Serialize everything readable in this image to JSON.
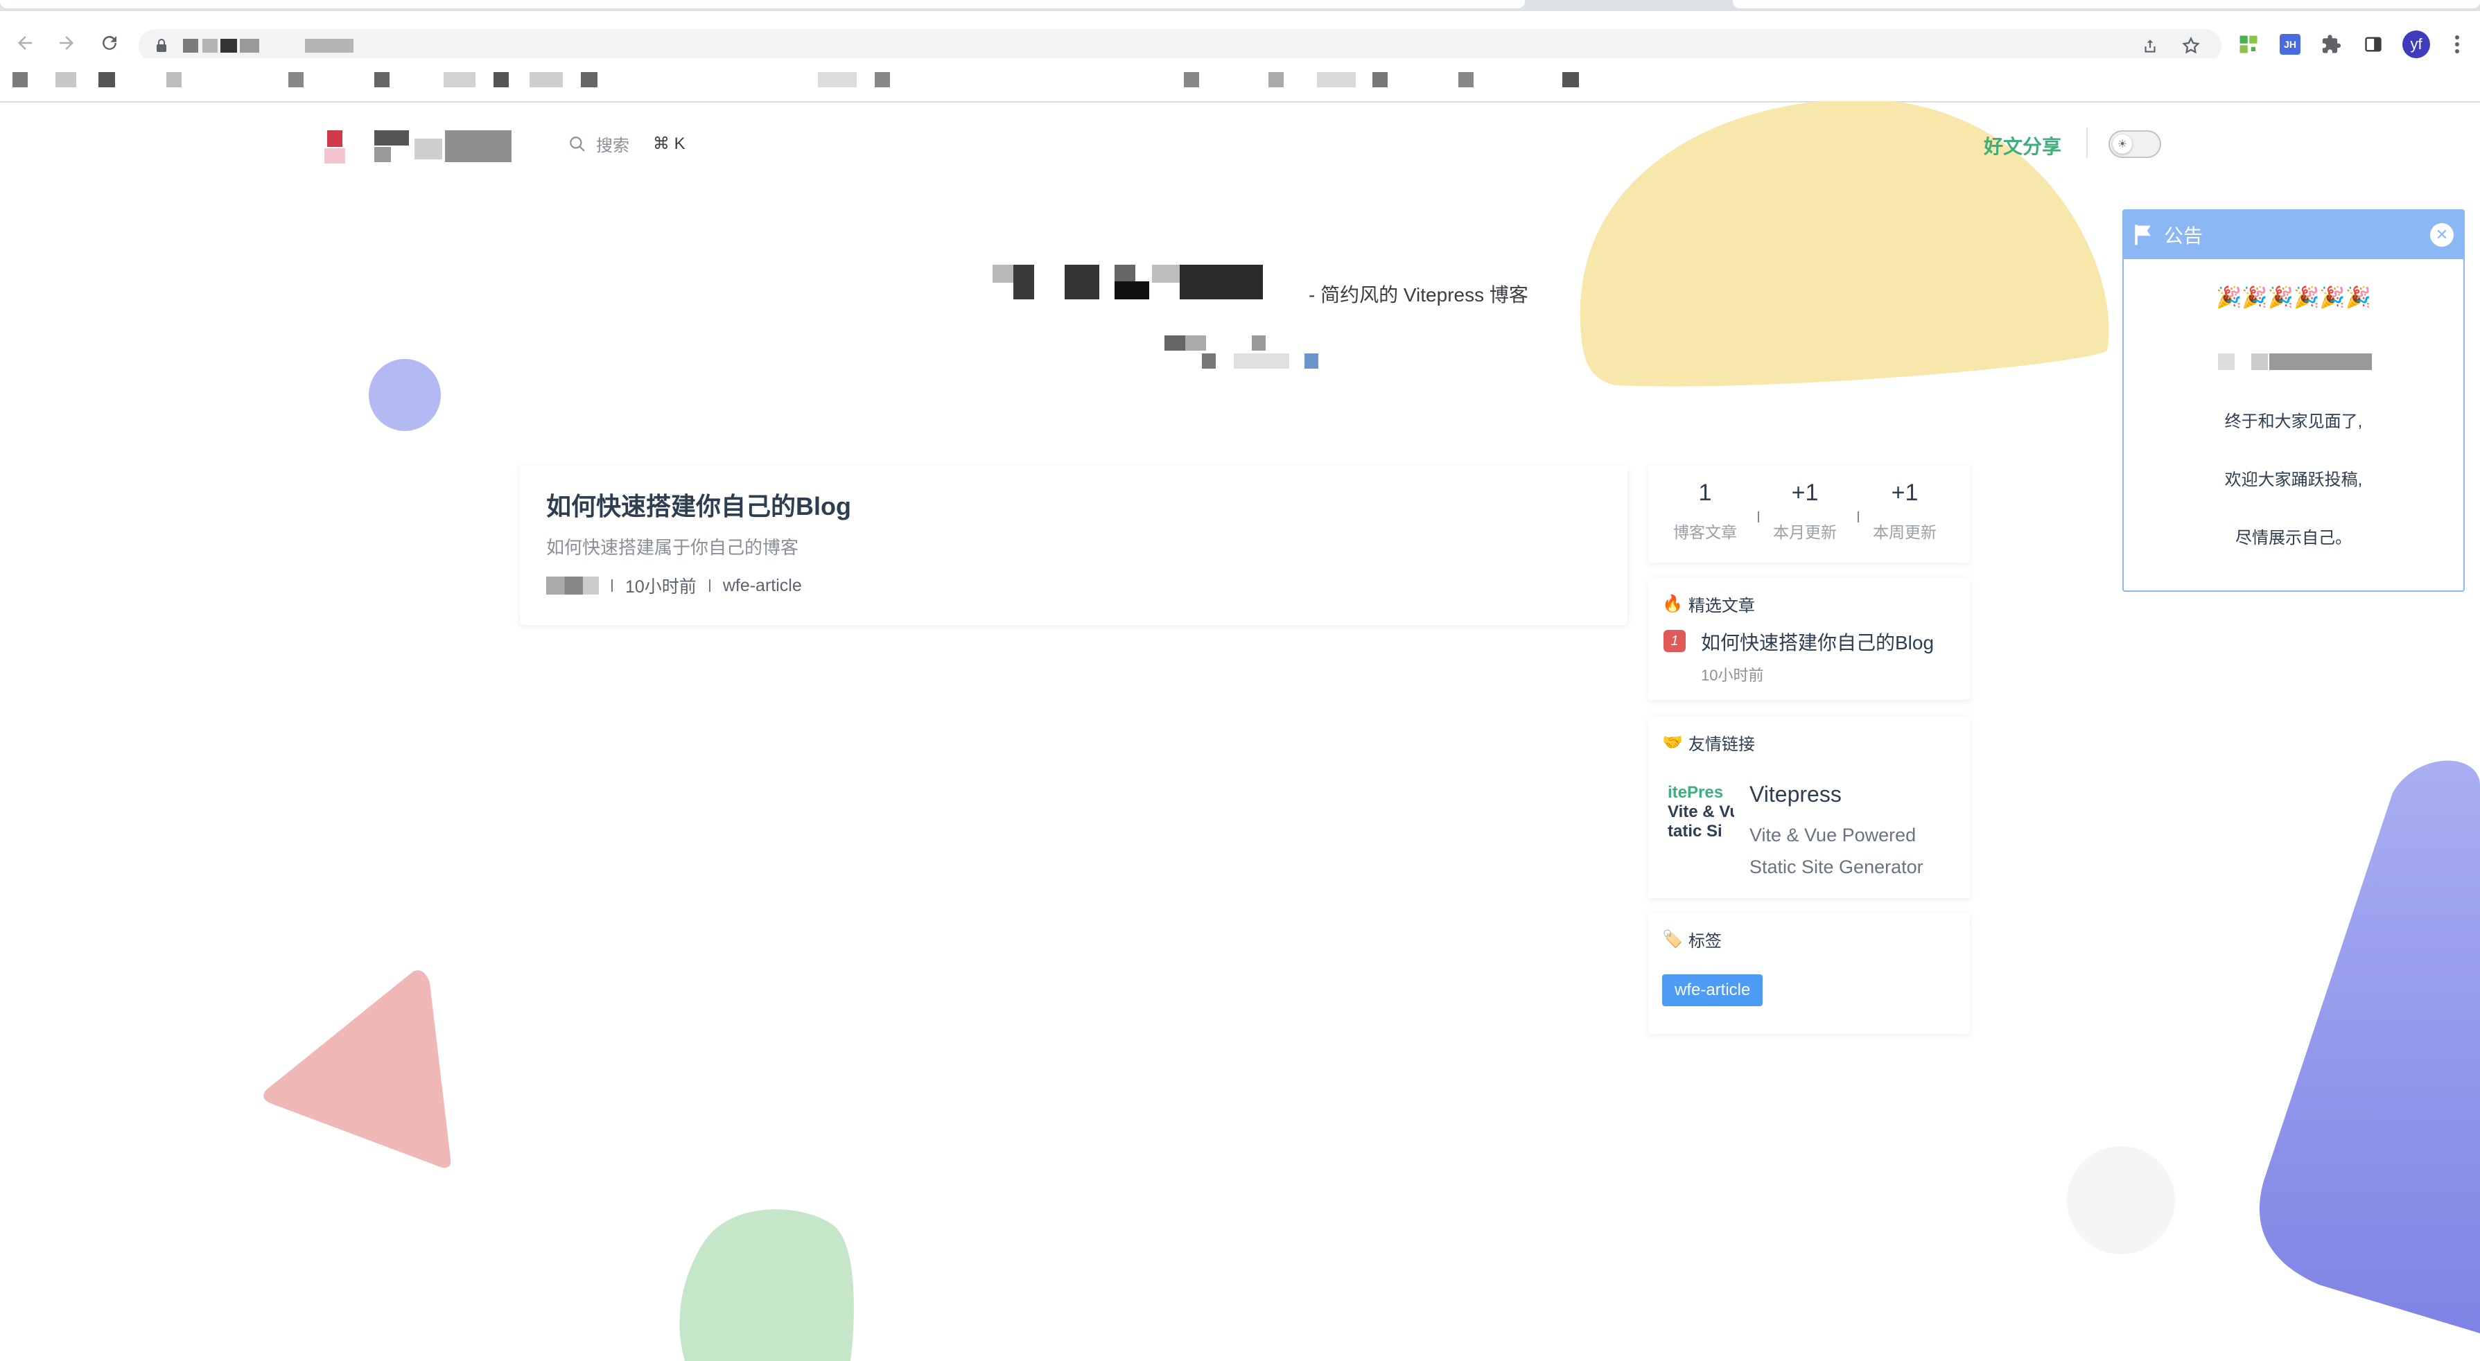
{
  "browser": {
    "address_blurred": "",
    "profile_initials": "yf",
    "ext_jh_label": "JH"
  },
  "header": {
    "search_placeholder": "搜索",
    "search_shortcut": "⌘ K",
    "nav_link": "好文分享"
  },
  "hero": {
    "subtitle": "- 简约风的 Vitepress 博客"
  },
  "post": {
    "title": "如何快速搭建你自己的Blog",
    "description": "如何快速搭建属于你自己的博客",
    "time": "10小时前",
    "tag": "wfe-article"
  },
  "stats": [
    {
      "value": "1",
      "label": "博客文章"
    },
    {
      "value": "+1",
      "label": "本月更新"
    },
    {
      "value": "+1",
      "label": "本周更新"
    }
  ],
  "featured": {
    "title": "精选文章",
    "rank": "1",
    "item_title": "如何快速搭建你自己的Blog",
    "item_time": "10小时前"
  },
  "friends": {
    "title": "友情链接",
    "logo_lines": [
      "itePres",
      "Vite & Vu",
      "tatic Si"
    ],
    "name": "Vitepress",
    "description": "Vite & Vue Powered Static Site Generator"
  },
  "tags": {
    "title": "标签",
    "items": [
      "wfe-article"
    ]
  },
  "notice": {
    "title": "公告",
    "celebrate": "🎉🎉🎉🎉🎉🎉",
    "line1": "终于和大家见面了,",
    "line2": "欢迎大家踊跃投稿,",
    "line3": "尽情展示自己。"
  },
  "colors": {
    "accent": "#3eaf7c",
    "notice": "#8bb8f5",
    "tag": "#4e9bf5"
  }
}
